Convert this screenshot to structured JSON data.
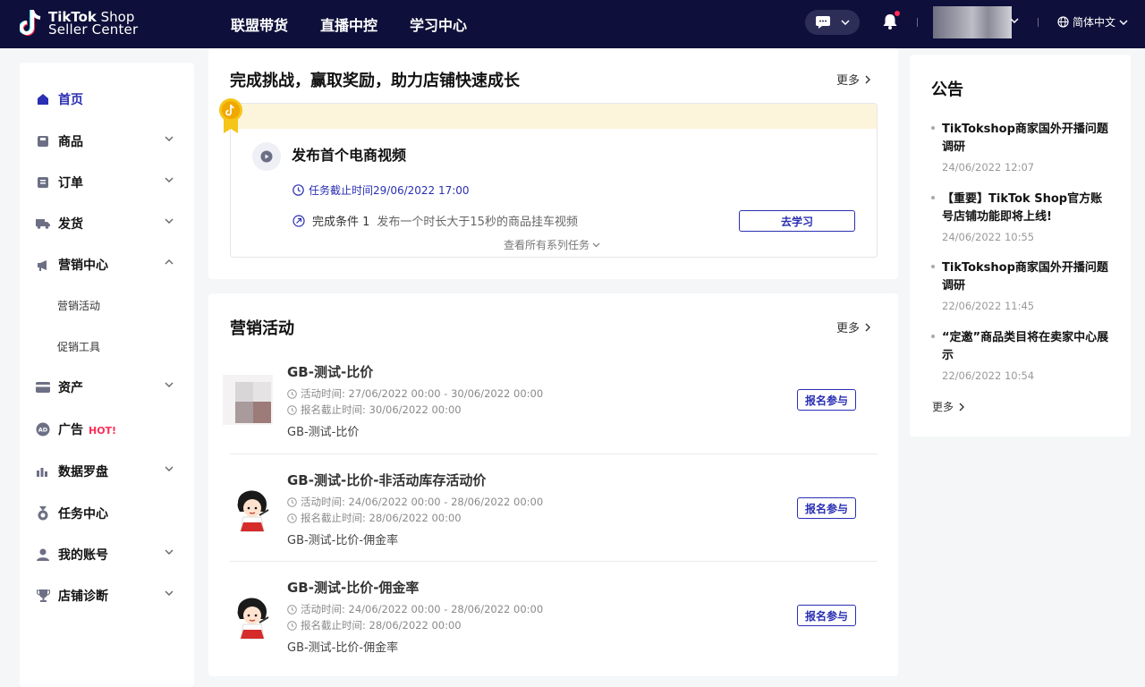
{
  "topbar": {
    "logo_line1_bold": "TikTok",
    "logo_line1_light": " Shop",
    "logo_line2": "Seller Center",
    "nav": [
      "联盟带货",
      "直播中控",
      "学习中心"
    ],
    "language": "简体中文"
  },
  "sidebar": {
    "items": [
      {
        "label": "首页",
        "icon": "home-icon"
      },
      {
        "label": "商品",
        "icon": "product-icon"
      },
      {
        "label": "订单",
        "icon": "order-icon"
      },
      {
        "label": "发货",
        "icon": "truck-icon"
      },
      {
        "label": "营销中心",
        "icon": "megaphone-icon"
      },
      {
        "label": "资产",
        "icon": "card-icon"
      },
      {
        "label": "广告",
        "icon": "ad-icon",
        "badge": "HOT!"
      },
      {
        "label": "数据罗盘",
        "icon": "chart-icon"
      },
      {
        "label": "任务中心",
        "icon": "medal-icon"
      },
      {
        "label": "我的账号",
        "icon": "user-icon"
      },
      {
        "label": "店铺诊断",
        "icon": "trophy-icon"
      }
    ],
    "sub_items": [
      "营销活动",
      "促销工具"
    ]
  },
  "challenge": {
    "title": "完成挑战，赢取奖励，助力店铺快速成长",
    "more": "更多",
    "task_title": "发布首个电商视频",
    "deadline": "任务截止时间29/06/2022 17:00",
    "condition_label": "完成条件 1",
    "condition_desc": "发布一个时长大于15秒的商品挂车视频",
    "learn_button": "去学习",
    "view_all": "查看所有系列任务"
  },
  "marketing": {
    "title": "营销活动",
    "more": "更多",
    "activities": [
      {
        "name": "GB-测试-比价",
        "active_time": "活动时间: 27/06/2022 00:00 - 30/06/2022 00:00",
        "signup_deadline": "报名截止时间: 30/06/2022 00:00",
        "desc": "GB-测试-比价",
        "button": "报名参与"
      },
      {
        "name": "GB-测试-比价-非活动库存活动价",
        "active_time": "活动时间: 24/06/2022 00:00 - 28/06/2022 00:00",
        "signup_deadline": "报名截止时间: 28/06/2022 00:00",
        "desc": "GB-测试-比价-佣金率",
        "button": "报名参与"
      },
      {
        "name": "GB-测试-比价-佣金率",
        "active_time": "活动时间: 24/06/2022 00:00 - 28/06/2022 00:00",
        "signup_deadline": "报名截止时间: 28/06/2022 00:00",
        "desc": "GB-测试-比价-佣金率",
        "button": "报名参与"
      }
    ]
  },
  "announcements": {
    "title": "公告",
    "items": [
      {
        "title": "TikTokshop商家国外开播问题调研",
        "date": "24/06/2022 12:07"
      },
      {
        "title": "【重要】TikTok Shop官方账号店铺功能即将上线!",
        "date": "24/06/2022 10:55"
      },
      {
        "title": "TikTokshop商家国外开播问题调研",
        "date": "22/06/2022 11:45"
      },
      {
        "title": "“定邀”商品类目将在卖家中心展示",
        "date": "22/06/2022 10:54"
      }
    ],
    "more": "更多"
  },
  "colors": {
    "topbar": "#0e0f3a",
    "accent": "#2a2fb3",
    "hot": "#fe2c55",
    "task_band": "#fdf4dc"
  }
}
